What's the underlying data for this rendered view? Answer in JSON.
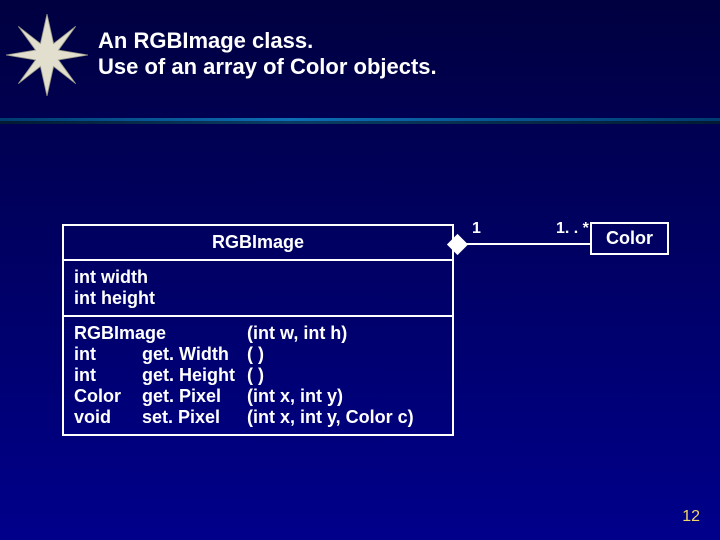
{
  "title": {
    "line1": "An RGBImage class.",
    "line2": "Use of an array of Color objects."
  },
  "uml": {
    "className": "RGBImage",
    "attributes": [
      "int width",
      "int height"
    ],
    "methods": [
      {
        "ret": "",
        "name": "RGBImage",
        "params": "(int w, int h)"
      },
      {
        "ret": "int",
        "name": "get. Width",
        "params": "( )"
      },
      {
        "ret": "int",
        "name": "get. Height",
        "params": "( )"
      },
      {
        "ret": "Color",
        "name": "get. Pixel",
        "params": "(int x, int y)"
      },
      {
        "ret": "void",
        "name": "set. Pixel",
        "params": "(int x, int y, Color c)"
      }
    ]
  },
  "assoc": {
    "leftMult": "1",
    "rightMult": "1. . *",
    "targetClass": "Color"
  },
  "pageNumber": "12"
}
